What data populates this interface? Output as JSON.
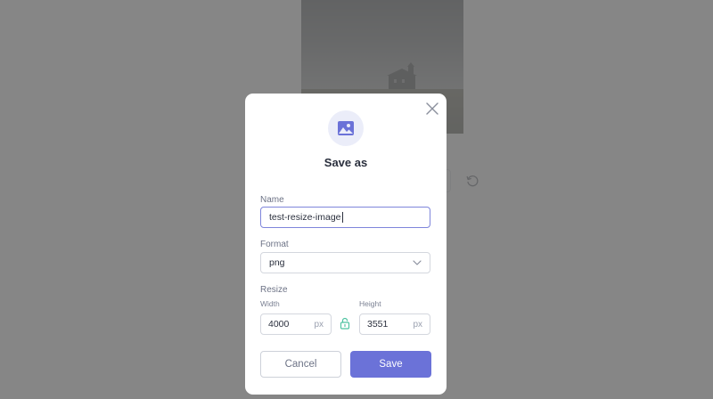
{
  "dialog": {
    "title": "Save as",
    "name_label": "Name",
    "name_value": "test-resize-image",
    "format_label": "Format",
    "format_value": "png",
    "resize_label": "Resize",
    "width_label": "Width",
    "width_value": "4000",
    "width_unit": "px",
    "height_label": "Height",
    "height_value": "3551",
    "height_unit": "px",
    "cancel_label": "Cancel",
    "save_label": "Save"
  },
  "icons": {
    "header": "image-icon",
    "close": "close-icon",
    "format_dropdown": "chevron-down-icon",
    "aspect_lock": "unlock-icon",
    "background_reset": "rotate-ccw-icon"
  },
  "colors": {
    "accent": "#6b72d8",
    "lock": "#4fc3a1",
    "overlay": "rgba(110,110,110,0.83)"
  }
}
